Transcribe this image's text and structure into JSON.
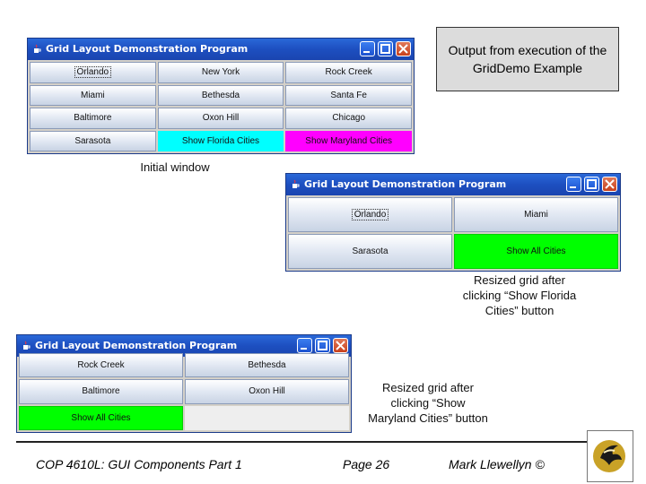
{
  "window_title": "Grid Layout Demonstration Program",
  "info_box": "Output from execution of the GridDemo Example",
  "captions": {
    "initial": "Initial window",
    "florida": [
      "Resized grid after",
      "clicking “Show Florida",
      "Cities” button"
    ],
    "maryland": [
      "Resized grid after",
      "clicking “Show",
      "Maryland Cities” button"
    ]
  },
  "win1": {
    "buttons": [
      "Orlando",
      "New York",
      "Rock Creek",
      "Miami",
      "Bethesda",
      "Santa Fe",
      "Baltimore",
      "Oxon Hill",
      "Chicago",
      "Sarasota",
      "Show Florida Cities",
      "Show Maryland Cities"
    ]
  },
  "win2": {
    "buttons": [
      "Orlando",
      "Miami",
      "Sarasota",
      "Show All Cities"
    ]
  },
  "win3": {
    "buttons": [
      "Rock Creek",
      "Bethesda",
      "Baltimore",
      "Oxon Hill",
      "Show All Cities"
    ]
  },
  "footer": {
    "course": "COP 4610L: GUI Components Part 1",
    "page": "Page 26",
    "author": "Mark Llewellyn ©"
  },
  "colors": {
    "cyan": "#00ffff",
    "magenta": "#ff00ff",
    "green": "#00ff00",
    "titlebar": "#1d4fc0"
  }
}
